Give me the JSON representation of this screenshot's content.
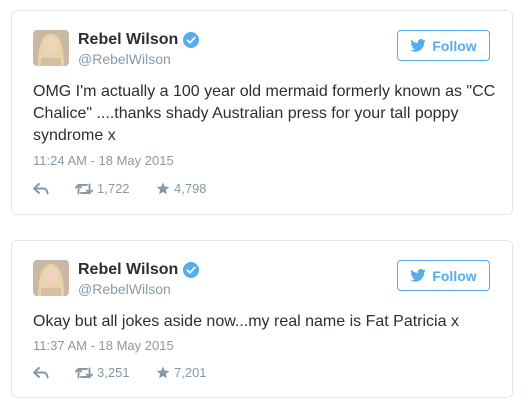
{
  "tweets": [
    {
      "author_name": "Rebel Wilson",
      "handle": "@RebelWilson",
      "follow_label": "Follow",
      "text": "OMG I'm actually a 100 year old mermaid formerly known as \"CC Chalice\" ....thanks shady Australian press for your tall poppy syndrome x",
      "timestamp": "11:24 AM - 18 May 2015",
      "retweets": "1,722",
      "favorites": "4,798"
    },
    {
      "author_name": "Rebel Wilson",
      "handle": "@RebelWilson",
      "follow_label": "Follow",
      "text": "Okay but all jokes aside now...my real name is Fat Patricia x",
      "timestamp": "11:37 AM - 18 May 2015",
      "retweets": "3,251",
      "favorites": "7,201"
    }
  ],
  "colors": {
    "accent": "#55acee",
    "muted": "#8899a6",
    "text": "#292f33",
    "border": "#e1e8ed"
  },
  "icons": [
    "verified-icon",
    "twitter-bird-icon",
    "reply-icon",
    "retweet-icon",
    "favorite-icon"
  ]
}
